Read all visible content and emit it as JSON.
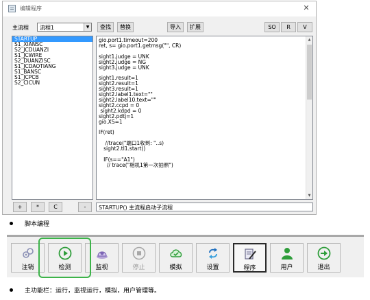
{
  "window": {
    "title": "编辑程序",
    "close_glyph": "✕"
  },
  "left_panel": {
    "flow_label": "主流程",
    "flow_select_value": "流程1",
    "items": [
      "STARTUP",
      "S1_XIANSC",
      "S2_JCDUANZI",
      "S1_JCWIRE",
      "S2_DUANZISC",
      "S1_JCDAOTIANG",
      "S1_BANSC",
      "S1_JCPCB",
      "S2_CICUN"
    ],
    "selected_index": 0,
    "btn_add": "+",
    "btn_star": "*",
    "btn_c": "C",
    "btn_minus": "-"
  },
  "top_buttons": {
    "find": "查找",
    "replace": "替换",
    "import": "导入",
    "extend": "扩展",
    "so": "SO",
    "r": "R",
    "v": "V"
  },
  "code": "gio.port1.timeout=200\nret, s= gio.port1.getmsg(\"\", CR)\n\nsight1.judge = UNK\nsight2.judge = NG\nsight3.judge = UNK\n\nsight1.result=1\nsight2.result=1\nsight3.result=1\nsight2.label1.text=\"\"\nsight2.label10.text=\"\"\nsight2.ccpd = 0\n sight2.kdpd = 0\nsight2.pdtj=1\ngio.XS=1\n\nIF(ret)\n\n    //trace(\"端口1收到: \"..s)\n   sight2.tl1.start()\n\n   IF(s==\"A1\")\n     // trace(\"相机1第一次拍照\")",
  "status_text": "STARTUP() 主流程启动子流程",
  "caption1": "脚本编程",
  "caption2": "主功能栏：运行，监视运行，模拟，用户管理等。",
  "toolbar": [
    {
      "label": "注销",
      "icon": "logout-link-icon",
      "state": "normal"
    },
    {
      "label": "检测",
      "icon": "play-icon",
      "state": "normal"
    },
    {
      "label": "监视",
      "icon": "monitor-icon",
      "state": "normal"
    },
    {
      "label": "停止",
      "icon": "stop-icon",
      "state": "disabled"
    },
    {
      "label": "模拟",
      "icon": "cloud-check-icon",
      "state": "normal"
    },
    {
      "label": "设置",
      "icon": "sync-arrows-icon",
      "state": "normal"
    },
    {
      "label": "程序",
      "icon": "document-pen-icon",
      "state": "active"
    },
    {
      "label": "用户",
      "icon": "user-icon",
      "state": "normal"
    },
    {
      "label": "退出",
      "icon": "exit-icon",
      "state": "normal"
    }
  ],
  "colors": {
    "highlight_green": "#3db34a",
    "selection_blue": "#3399ff",
    "play_green": "#2e9d3a",
    "icon_blue": "#1f6fbf"
  }
}
